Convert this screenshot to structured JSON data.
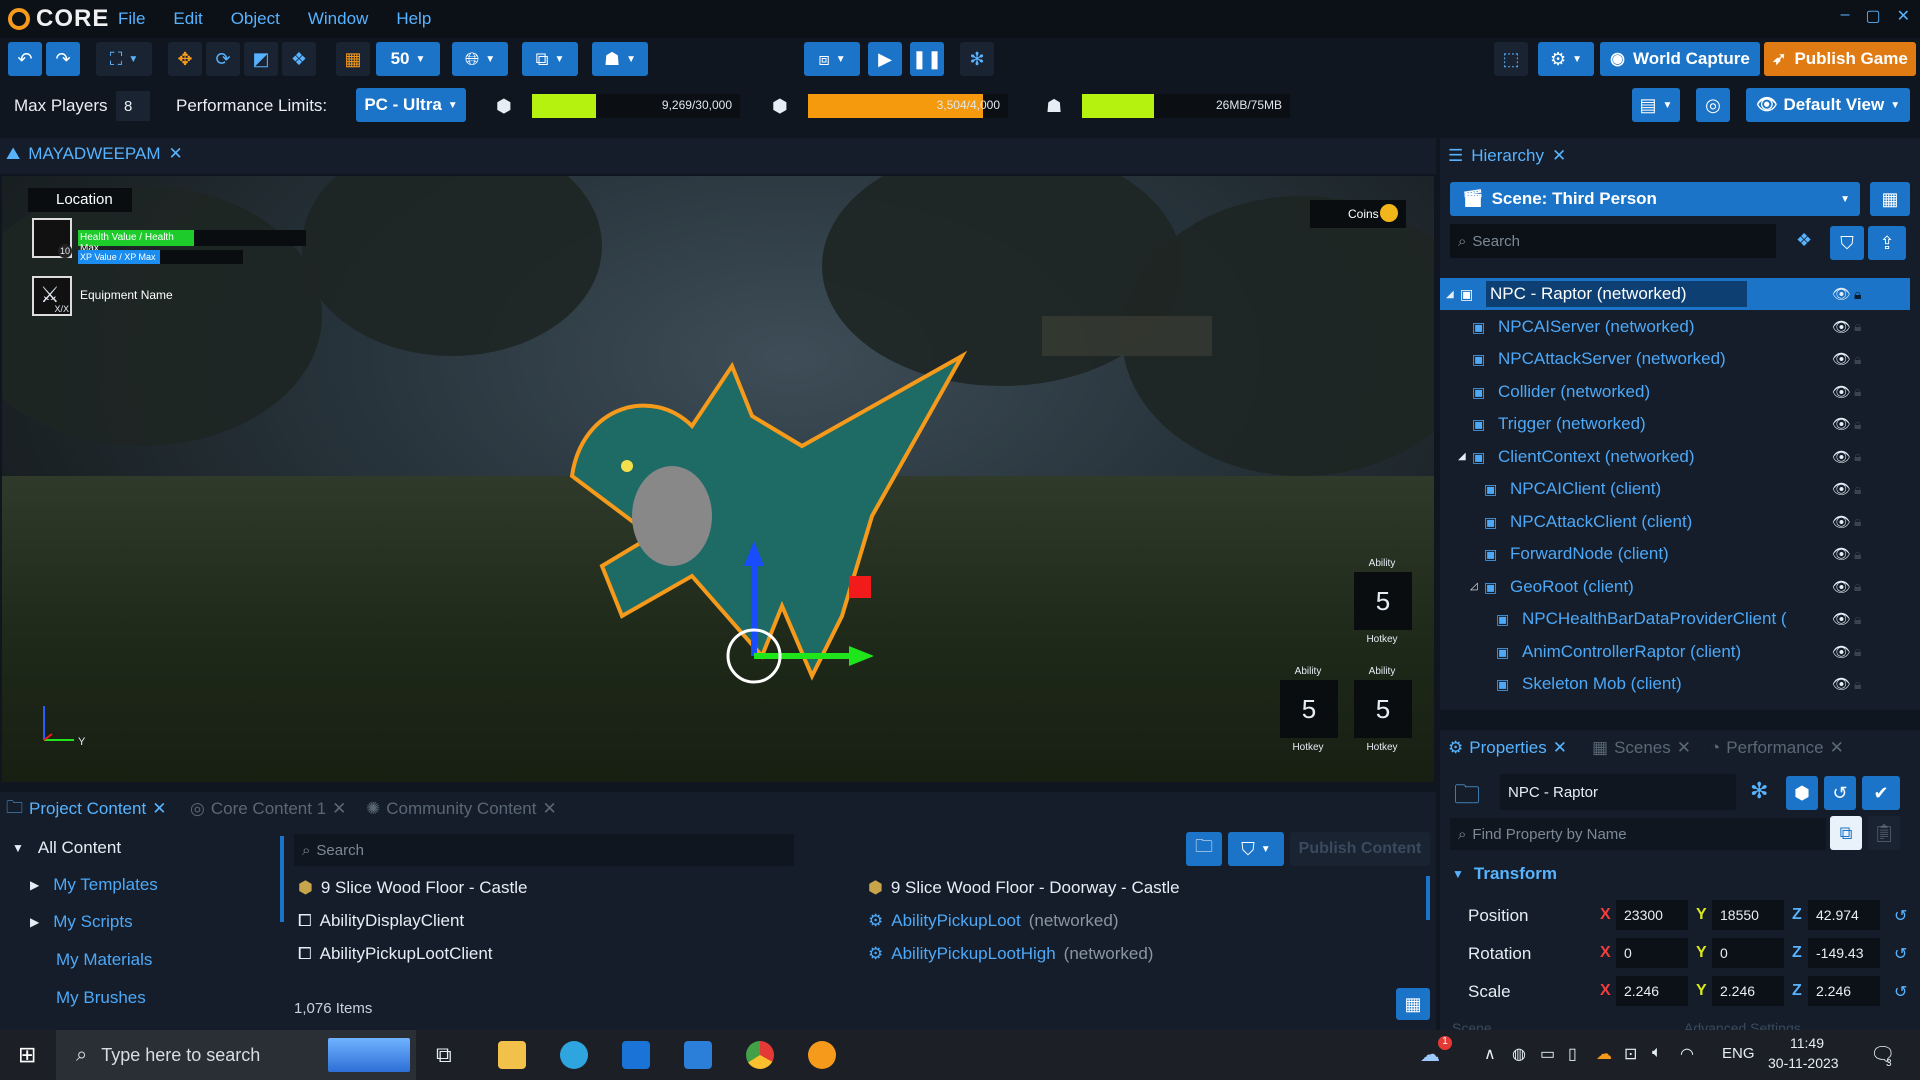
{
  "app": {
    "brand": "CORE",
    "menu": [
      "File",
      "Edit",
      "Object",
      "Window",
      "Help"
    ],
    "window_controls": [
      "–",
      "▢",
      "✕"
    ]
  },
  "toolbar": {
    "grid_size": "50",
    "world_capture_label": "World Capture",
    "publish_game_label": "Publish Game",
    "default_view_label": "Default View"
  },
  "perf": {
    "max_players_label": "Max Players",
    "max_players_value": "8",
    "limits_label": "Performance Limits:",
    "limits_value": "PC - Ultra",
    "meters": [
      {
        "text": "9,269/30,000",
        "fraction": 0.309,
        "color": "#b5f20f"
      },
      {
        "text": "3,504/4,000",
        "fraction": 0.876,
        "color": "#f59a0c"
      },
      {
        "text": "26MB/75MB",
        "fraction": 0.347,
        "color": "#b5f20f"
      }
    ]
  },
  "viewport": {
    "tab_label": "MAYADWEEPAM",
    "hud": {
      "location": "Location",
      "health": "Health Value / Health Max",
      "xp": "XP Value / XP Max",
      "level": "10",
      "equip_count": "X/X",
      "equipment": "Equipment Name",
      "coins": "Coins",
      "ability_label": "Ability",
      "ability_value": "5",
      "hotkey_label": "Hotkey"
    },
    "axis_y": "Y"
  },
  "hierarchy": {
    "title": "Hierarchy",
    "scene_label": "Scene: Third Person",
    "search_placeholder": "Search",
    "rows": [
      {
        "label": "NPC - Raptor (networked)",
        "indent": 0,
        "selected": true,
        "arrow": "◢"
      },
      {
        "label": "NPCAIServer (networked)",
        "indent": 1,
        "selected": false,
        "arrow": ""
      },
      {
        "label": "NPCAttackServer (networked)",
        "indent": 1,
        "selected": false,
        "arrow": ""
      },
      {
        "label": "Collider (networked)",
        "indent": 1,
        "selected": false,
        "arrow": ""
      },
      {
        "label": "Trigger (networked)",
        "indent": 1,
        "selected": false,
        "arrow": ""
      },
      {
        "label": "ClientContext (networked)",
        "indent": 1,
        "selected": false,
        "arrow": "◢"
      },
      {
        "label": "NPCAIClient (client)",
        "indent": 2,
        "selected": false,
        "arrow": ""
      },
      {
        "label": "NPCAttackClient (client)",
        "indent": 2,
        "selected": false,
        "arrow": ""
      },
      {
        "label": "ForwardNode (client)",
        "indent": 2,
        "selected": false,
        "arrow": ""
      },
      {
        "label": "GeoRoot (client)",
        "indent": 2,
        "selected": false,
        "arrow": "◿"
      },
      {
        "label": "NPCHealthBarDataProviderClient (",
        "indent": 3,
        "selected": false,
        "arrow": ""
      },
      {
        "label": "AnimControllerRaptor (client)",
        "indent": 3,
        "selected": false,
        "arrow": ""
      },
      {
        "label": "Skeleton Mob (client)",
        "indent": 3,
        "selected": false,
        "arrow": ""
      }
    ]
  },
  "properties": {
    "tabs": [
      "Properties",
      "Scenes",
      "Performance"
    ],
    "object_name": "NPC - Raptor",
    "find_placeholder": "Find Property by Name",
    "section": "Transform",
    "rows": [
      {
        "label": "Position",
        "x": "23300",
        "y": "18550",
        "z": "42.974"
      },
      {
        "label": "Rotation",
        "x": "0",
        "y": "0",
        "z": "-149.43"
      },
      {
        "label": "Scale",
        "x": "2.246",
        "y": "2.246",
        "z": "2.246"
      }
    ],
    "axis_x": "X",
    "axis_y": "Y",
    "axis_z": "Z",
    "cut_left": "Scene",
    "cut_right": "Advanced Settings"
  },
  "content": {
    "tabs": [
      "Project Content",
      "Core Content 1",
      "Community Content"
    ],
    "tree": [
      "All Content",
      "My Templates",
      "My Scripts",
      "My Materials",
      "My Brushes"
    ],
    "search_placeholder": "Search",
    "publish_label": "Publish Content",
    "items_left": [
      {
        "name": "9 Slice Wood Floor - Castle",
        "suffix": "",
        "link": false
      },
      {
        "name": "AbilityDisplayClient",
        "suffix": "",
        "link": false
      },
      {
        "name": "AbilityPickupLootClient",
        "suffix": "",
        "link": false
      }
    ],
    "items_right": [
      {
        "name": "9 Slice Wood Floor - Doorway - Castle",
        "suffix": "",
        "link": false
      },
      {
        "name": "AbilityPickupLoot",
        "suffix": "(networked)",
        "link": true
      },
      {
        "name": "AbilityPickupLootHigh",
        "suffix": "(networked)",
        "link": true
      }
    ],
    "count": "1,076 Items"
  },
  "taskbar": {
    "search_placeholder": "Type here to search",
    "lang": "ENG",
    "time": "11:49",
    "date": "30-11-2023",
    "notif_badge": "1",
    "chat_badge": "3"
  }
}
